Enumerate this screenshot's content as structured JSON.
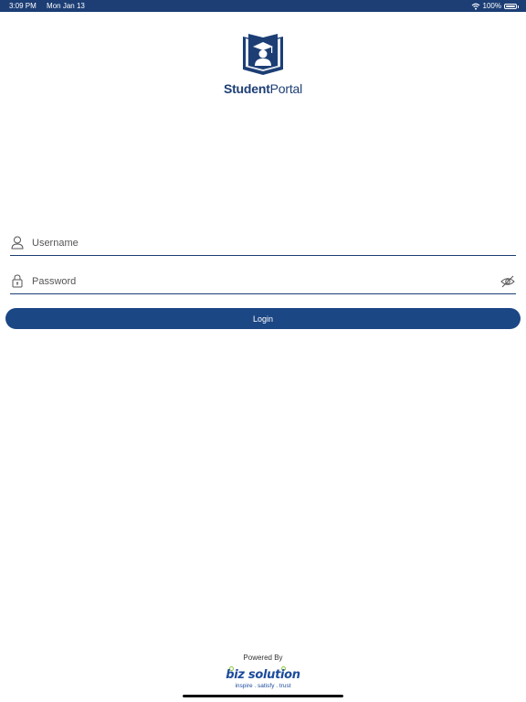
{
  "status_bar": {
    "time": "3:09 PM",
    "date": "Mon Jan 13",
    "battery": "100%",
    "wifi_icon": "wifi-icon",
    "battery_icon": "battery-icon",
    "background": "#1c3e75"
  },
  "brand": {
    "logo_icon": "graduate-book-icon",
    "name_bold": "Student",
    "name_regular": "Portal",
    "color": "#1c3e75"
  },
  "form": {
    "username_placeholder": "Username",
    "username_value": "",
    "password_placeholder": "Password",
    "password_value": "",
    "user_icon": "user-icon",
    "lock_icon": "lock-icon",
    "toggle_icon": "eye-slash-icon",
    "login_label": "Login",
    "accent": "#1c4785"
  },
  "footer": {
    "powered_by": "Powered By",
    "company_name": "biz solution",
    "tagline": "inspire . satisfy . trust",
    "company_color": "#1c4b9c",
    "dot_color": "#8cc63f"
  }
}
